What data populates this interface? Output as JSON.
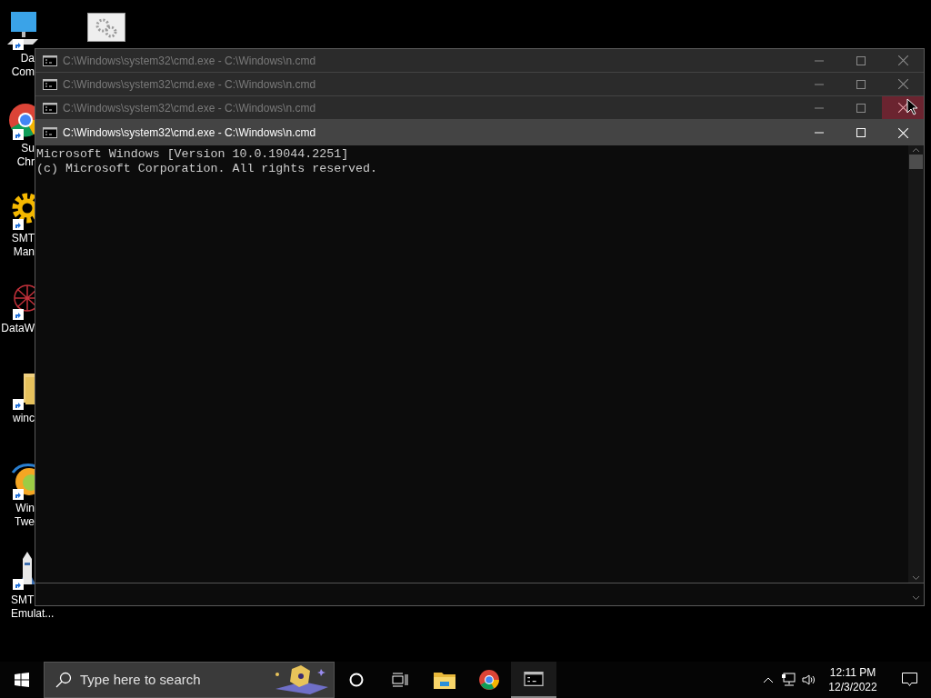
{
  "desktop_icons": [
    {
      "kind": "computer",
      "label_lines": [
        "Da",
        "Com"
      ],
      "covered": true
    },
    {
      "kind": "browser",
      "label_lines": [
        "Su",
        "Chr"
      ],
      "covered": true
    },
    {
      "kind": "gear",
      "label_lines": [
        "SMT",
        "Man"
      ],
      "covered": true
    },
    {
      "kind": "web",
      "label_lines": [
        "DataW"
      ],
      "covered": true
    },
    {
      "kind": "folder",
      "label_lines": [
        "winc"
      ],
      "covered": true
    },
    {
      "kind": "swirl",
      "label_lines": [
        "Win",
        "Twe"
      ],
      "covered": true
    },
    {
      "kind": "rocket",
      "label_lines": [
        "SMT",
        "Emulat..."
      ],
      "covered": false
    }
  ],
  "windows": [
    {
      "title": "C:\\Windows\\system32\\cmd.exe - C:\\Windows\\n.cmd",
      "active": false,
      "close_hovered": false
    },
    {
      "title": "C:\\Windows\\system32\\cmd.exe - C:\\Windows\\n.cmd",
      "active": false,
      "close_hovered": false
    },
    {
      "title": "C:\\Windows\\system32\\cmd.exe - C:\\Windows\\n.cmd",
      "active": false,
      "close_hovered": true
    },
    {
      "title": "C:\\Windows\\system32\\cmd.exe - C:\\Windows\\n.cmd",
      "active": true,
      "close_hovered": false
    }
  ],
  "console_lines": [
    "Microsoft Windows [Version 10.0.19044.2251]",
    "(c) Microsoft Corporation. All rights reserved."
  ],
  "taskbar": {
    "search": {
      "placeholder": "Type here to search"
    },
    "clock": {
      "time": "12:11 PM",
      "date": "12/3/2022"
    }
  }
}
